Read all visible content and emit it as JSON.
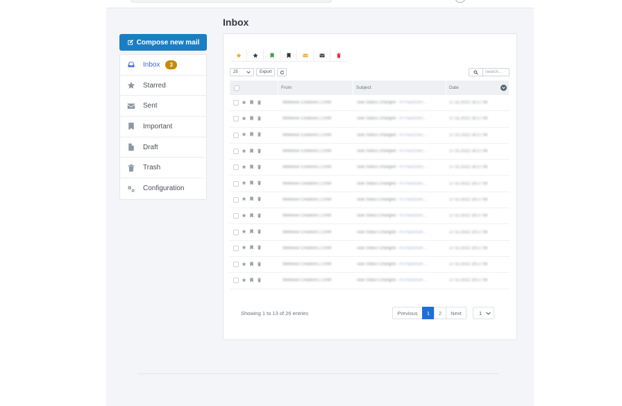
{
  "page_title": "Inbox",
  "compose": {
    "label": "Compose new mail"
  },
  "menu": [
    {
      "label": "Inbox",
      "icon": "inbox-icon",
      "badge": "3",
      "active": true
    },
    {
      "label": "Starred",
      "icon": "star-icon"
    },
    {
      "label": "Sent",
      "icon": "envelope-icon"
    },
    {
      "label": "Important",
      "icon": "bookmark-icon"
    },
    {
      "label": "Draft",
      "icon": "file-icon"
    },
    {
      "label": "Trash",
      "icon": "trash-icon"
    },
    {
      "label": "Configuration",
      "icon": "gears-icon"
    }
  ],
  "filters": [
    {
      "icon": "star-icon",
      "color": "#f0a92e"
    },
    {
      "icon": "star-icon",
      "color": "#343a40"
    },
    {
      "icon": "bookmark-icon",
      "color": "#35a64f"
    },
    {
      "icon": "bookmark-icon",
      "color": "#343a40"
    },
    {
      "icon": "envelope-icon",
      "color": "#f0a92e"
    },
    {
      "icon": "envelope-icon",
      "color": "#343a40"
    },
    {
      "icon": "trash-icon",
      "color": "#e03131"
    }
  ],
  "controls": {
    "page_size": "25",
    "export_label": "Export",
    "search_placeholder": "Search..."
  },
  "table": {
    "headers": [
      "",
      "From",
      "Subject",
      "Date"
    ],
    "rows": [
      {
        "from": "Webwise Creations | CRM",
        "subject": "Task Status Changed",
        "subject_rest": " - Hi PaulDram...",
        "date": "17-11-2022 18:17:08"
      },
      {
        "from": "Webwise Creations | CRM",
        "subject": "Task Status Changed",
        "subject_rest": " - Hi PaulDram...",
        "date": "17-11-2022 18:17:08"
      },
      {
        "from": "Webwise Creations | CRM",
        "subject": "Task Status Changed",
        "subject_rest": " - Hi PaulDram...",
        "date": "17-11-2022 18:17:08"
      },
      {
        "from": "Webwise Creations | CRM",
        "subject": "Task Status Changed",
        "subject_rest": " - Hi PaulDram...",
        "date": "17-11-2022 18:17:08"
      },
      {
        "from": "Webwise Creations | CRM",
        "subject": "Task Status Changed",
        "subject_rest": " - Hi PaulDram...",
        "date": "17-11-2022 18:17:08"
      },
      {
        "from": "Webwise Creations | CRM",
        "subject": "Task Status Changed",
        "subject_rest": " - Hi PaulDram...",
        "date": "17-11-2022 18:17:08"
      },
      {
        "from": "Webwise Creations | CRM",
        "subject": "Task Status Changed",
        "subject_rest": " - Hi PaulDram...",
        "date": "17-11-2022 18:17:08"
      },
      {
        "from": "Webwise Creations | CRM",
        "subject": "Task Status Changed",
        "subject_rest": " - Hi PaulDram...",
        "date": "17-11-2022 18:17:08"
      },
      {
        "from": "Webwise Creations | CRM",
        "subject": "Task Status Changed",
        "subject_rest": " - Hi PaulDram...",
        "date": "17-11-2022 18:17:08"
      },
      {
        "from": "Webwise Creations | CRM",
        "subject": "Task Status Changed",
        "subject_rest": " - Hi PaulDram...",
        "date": "17-11-2022 18:17:08"
      },
      {
        "from": "Webwise Creations | CRM",
        "subject": "Task Status Changed",
        "subject_rest": " - Hi PaulDram...",
        "date": "17-11-2022 18:17:08"
      },
      {
        "from": "Webwise Creations | CRM",
        "subject": "Task Status Changed",
        "subject_rest": " - Hi PaulDram...",
        "date": "17-11-2022 18:17:08"
      }
    ]
  },
  "footer": {
    "info": "Showing 1 to 13 of 26 entries",
    "prev_label": "Previous",
    "pages": [
      "1",
      "2"
    ],
    "current_page": "1",
    "next_label": "Next",
    "page_select": "1"
  },
  "colors": {
    "accent": "#1a7ec4",
    "active_link": "#3f6ad8",
    "badge": "#c6890b",
    "pager_current": "#1d6fd8"
  }
}
